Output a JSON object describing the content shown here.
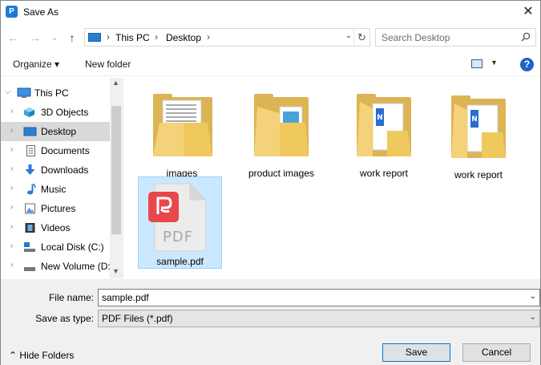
{
  "window": {
    "title": "Save As",
    "close_glyph": "✕",
    "app_icon": "wps-p-icon"
  },
  "nav": {
    "back_glyph": "←",
    "forward_glyph": "→",
    "recent_glyph": "⌄",
    "up_glyph": "↑",
    "breadcrumb": [
      "This PC",
      "Desktop"
    ],
    "separator": "›",
    "refresh_glyph": "↻",
    "dropdown_glyph": "⌄"
  },
  "search": {
    "placeholder": "Search Desktop"
  },
  "toolbar": {
    "organize_label": "Organize ▾",
    "new_folder_label": "New folder",
    "view_caret": "▼",
    "help_label": "?"
  },
  "sidebar": {
    "items": [
      {
        "label": "This PC",
        "icon": "monitor-icon",
        "expanded": true
      },
      {
        "label": "3D Objects",
        "icon": "cube-icon"
      },
      {
        "label": "Desktop",
        "icon": "desktop-icon",
        "selected": true
      },
      {
        "label": "Documents",
        "icon": "document-icon"
      },
      {
        "label": "Downloads",
        "icon": "download-arrow-icon"
      },
      {
        "label": "Music",
        "icon": "music-note-icon"
      },
      {
        "label": "Pictures",
        "icon": "picture-icon"
      },
      {
        "label": "Videos",
        "icon": "film-icon"
      },
      {
        "label": "Local Disk (C:)",
        "icon": "drive-icon"
      },
      {
        "label": "New Volume (D:",
        "icon": "drive-icon"
      }
    ],
    "scroll_up": "▲",
    "scroll_down": "▼"
  },
  "files": [
    {
      "label": "images",
      "type": "folder-with-papers"
    },
    {
      "label": "product images",
      "type": "folder-with-images"
    },
    {
      "label": "work report",
      "type": "folder-with-word-docs"
    },
    {
      "label": "work report",
      "type": "folder-with-word-docs"
    },
    {
      "label": "sample.pdf",
      "type": "pdf-file",
      "selected": true,
      "badge_text": "PDF"
    }
  ],
  "form": {
    "file_name_label": "File name:",
    "file_name_value": "sample.pdf",
    "save_type_label": "Save as type:",
    "save_type_value": "PDF Files (*.pdf)",
    "caret": "⌄"
  },
  "footer": {
    "hide_folders_label": "Hide Folders",
    "hide_glyph": "⌃",
    "save_label": "Save",
    "cancel_label": "Cancel"
  },
  "colors": {
    "accent": "#0078d7",
    "selection": "#cce8ff",
    "pdf_red": "#e8474c",
    "folder": "#f4d27a"
  }
}
